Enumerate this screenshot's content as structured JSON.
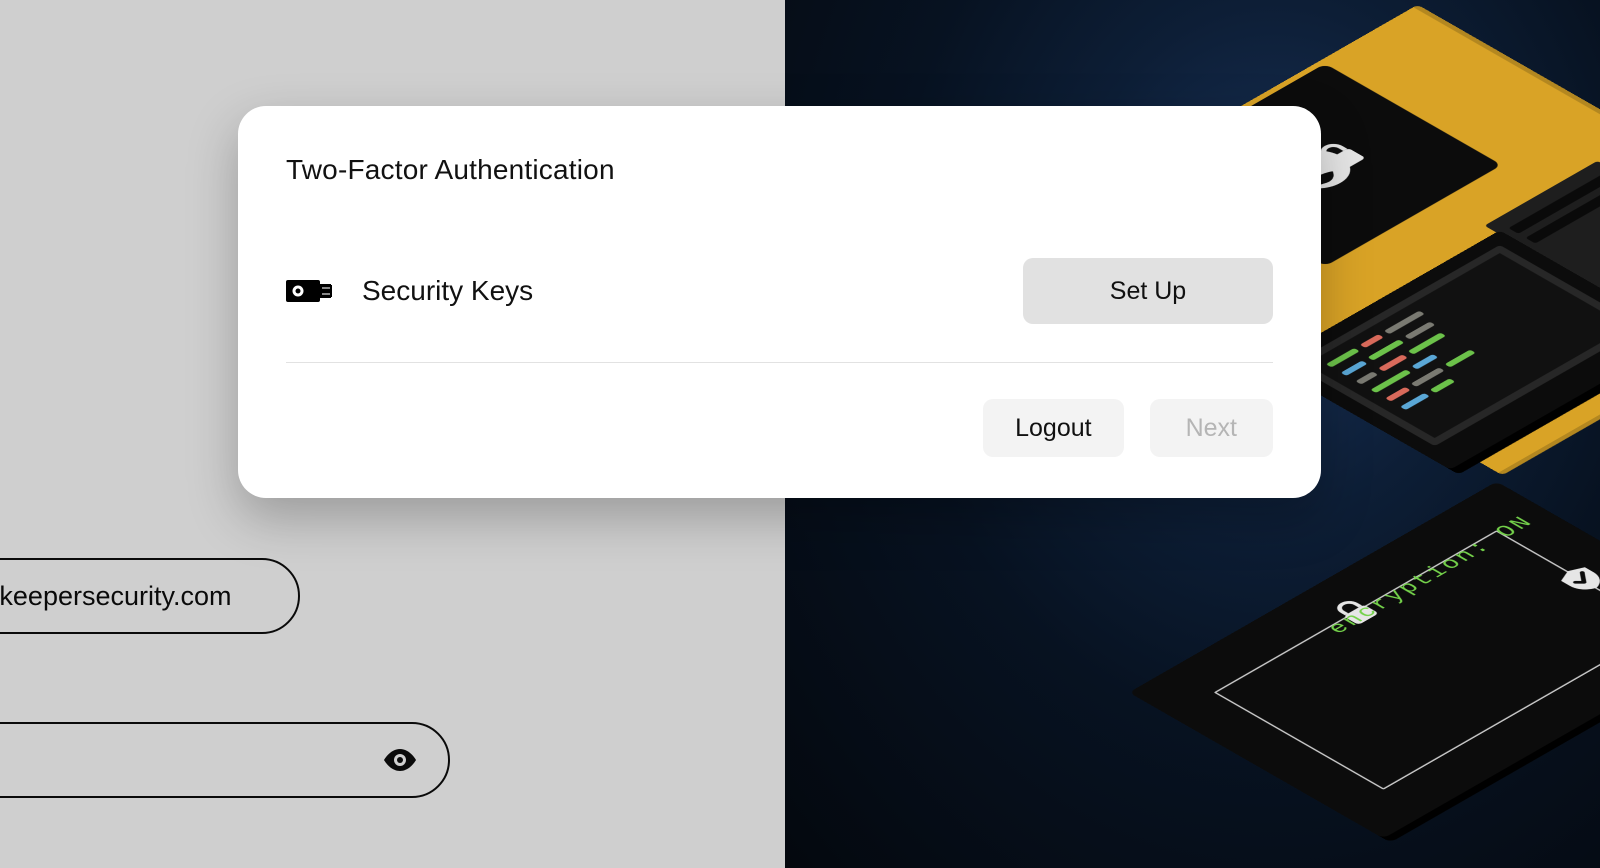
{
  "modal": {
    "title": "Two-Factor Authentication",
    "method": {
      "icon": "security-key-icon",
      "label": "Security Keys",
      "setup_label": "Set Up"
    },
    "actions": {
      "logout_label": "Logout",
      "next_label": "Next"
    }
  },
  "background_form": {
    "email_suffix": "@keepersecurity.com",
    "password_value": ""
  },
  "illustration": {
    "encryption_label": "encryption: ON"
  }
}
